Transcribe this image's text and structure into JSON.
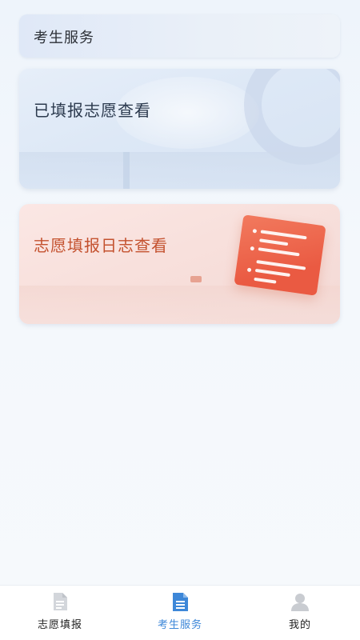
{
  "header": {
    "title": "考生服务"
  },
  "cards": [
    {
      "label": "已填报志愿查看",
      "theme": "blue",
      "color": "#2c3a4e"
    },
    {
      "label": "志愿填报日志查看",
      "theme": "red",
      "color": "#c4522f"
    }
  ],
  "tabbar": {
    "items": [
      {
        "label": "志愿填报",
        "icon": "document-icon",
        "active": false
      },
      {
        "label": "考生服务",
        "icon": "document-list-icon",
        "active": true
      },
      {
        "label": "我的",
        "icon": "user-icon",
        "active": false
      }
    ],
    "active_color": "#3d87d8",
    "inactive_icon_color": "#c9ccd1"
  }
}
